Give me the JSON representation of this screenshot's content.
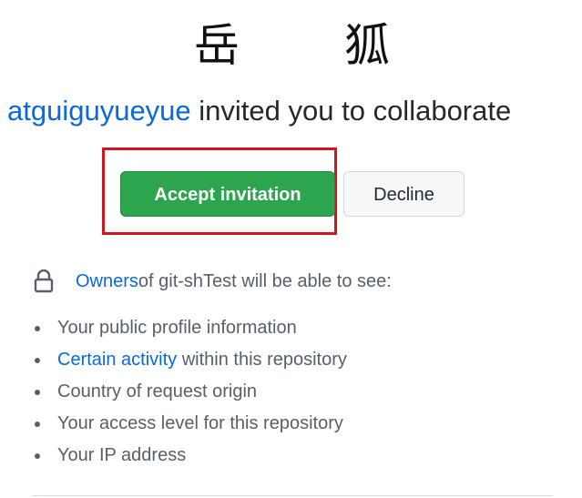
{
  "avatar": {
    "char1": "岳",
    "char2": "狐"
  },
  "invite": {
    "username": "atguiguyueyue",
    "message": " invited you to collaborate"
  },
  "actions": {
    "accept_label": "Accept invitation",
    "decline_label": "Decline"
  },
  "permissions": {
    "owners_link": "Owners",
    "owners_text": " of git-shTest will be able to see:",
    "items": [
      {
        "pre": "Your public profile information",
        "link": "",
        "post": ""
      },
      {
        "pre": "",
        "link": "Certain activity",
        "post": " within this repository"
      },
      {
        "pre": "Country of request origin",
        "link": "",
        "post": ""
      },
      {
        "pre": "Your access level for this repository",
        "link": "",
        "post": ""
      },
      {
        "pre": "Your IP address",
        "link": "",
        "post": ""
      }
    ]
  },
  "colors": {
    "accent_link": "#0969da",
    "accept_green": "#2da44e",
    "highlight_red": "#d0161d"
  },
  "icons": {
    "lock": "lock-icon"
  }
}
